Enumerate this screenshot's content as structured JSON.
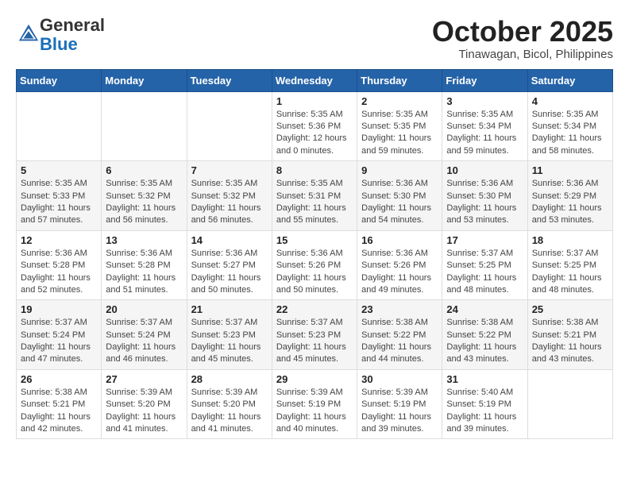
{
  "header": {
    "logo_general": "General",
    "logo_blue": "Blue",
    "month_title": "October 2025",
    "location": "Tinawagan, Bicol, Philippines"
  },
  "weekdays": [
    "Sunday",
    "Monday",
    "Tuesday",
    "Wednesday",
    "Thursday",
    "Friday",
    "Saturday"
  ],
  "weeks": [
    [
      {
        "day": "",
        "info": ""
      },
      {
        "day": "",
        "info": ""
      },
      {
        "day": "",
        "info": ""
      },
      {
        "day": "1",
        "info": "Sunrise: 5:35 AM\nSunset: 5:36 PM\nDaylight: 12 hours\nand 0 minutes."
      },
      {
        "day": "2",
        "info": "Sunrise: 5:35 AM\nSunset: 5:35 PM\nDaylight: 11 hours\nand 59 minutes."
      },
      {
        "day": "3",
        "info": "Sunrise: 5:35 AM\nSunset: 5:34 PM\nDaylight: 11 hours\nand 59 minutes."
      },
      {
        "day": "4",
        "info": "Sunrise: 5:35 AM\nSunset: 5:34 PM\nDaylight: 11 hours\nand 58 minutes."
      }
    ],
    [
      {
        "day": "5",
        "info": "Sunrise: 5:35 AM\nSunset: 5:33 PM\nDaylight: 11 hours\nand 57 minutes."
      },
      {
        "day": "6",
        "info": "Sunrise: 5:35 AM\nSunset: 5:32 PM\nDaylight: 11 hours\nand 56 minutes."
      },
      {
        "day": "7",
        "info": "Sunrise: 5:35 AM\nSunset: 5:32 PM\nDaylight: 11 hours\nand 56 minutes."
      },
      {
        "day": "8",
        "info": "Sunrise: 5:35 AM\nSunset: 5:31 PM\nDaylight: 11 hours\nand 55 minutes."
      },
      {
        "day": "9",
        "info": "Sunrise: 5:36 AM\nSunset: 5:30 PM\nDaylight: 11 hours\nand 54 minutes."
      },
      {
        "day": "10",
        "info": "Sunrise: 5:36 AM\nSunset: 5:30 PM\nDaylight: 11 hours\nand 53 minutes."
      },
      {
        "day": "11",
        "info": "Sunrise: 5:36 AM\nSunset: 5:29 PM\nDaylight: 11 hours\nand 53 minutes."
      }
    ],
    [
      {
        "day": "12",
        "info": "Sunrise: 5:36 AM\nSunset: 5:28 PM\nDaylight: 11 hours\nand 52 minutes."
      },
      {
        "day": "13",
        "info": "Sunrise: 5:36 AM\nSunset: 5:28 PM\nDaylight: 11 hours\nand 51 minutes."
      },
      {
        "day": "14",
        "info": "Sunrise: 5:36 AM\nSunset: 5:27 PM\nDaylight: 11 hours\nand 50 minutes."
      },
      {
        "day": "15",
        "info": "Sunrise: 5:36 AM\nSunset: 5:26 PM\nDaylight: 11 hours\nand 50 minutes."
      },
      {
        "day": "16",
        "info": "Sunrise: 5:36 AM\nSunset: 5:26 PM\nDaylight: 11 hours\nand 49 minutes."
      },
      {
        "day": "17",
        "info": "Sunrise: 5:37 AM\nSunset: 5:25 PM\nDaylight: 11 hours\nand 48 minutes."
      },
      {
        "day": "18",
        "info": "Sunrise: 5:37 AM\nSunset: 5:25 PM\nDaylight: 11 hours\nand 48 minutes."
      }
    ],
    [
      {
        "day": "19",
        "info": "Sunrise: 5:37 AM\nSunset: 5:24 PM\nDaylight: 11 hours\nand 47 minutes."
      },
      {
        "day": "20",
        "info": "Sunrise: 5:37 AM\nSunset: 5:24 PM\nDaylight: 11 hours\nand 46 minutes."
      },
      {
        "day": "21",
        "info": "Sunrise: 5:37 AM\nSunset: 5:23 PM\nDaylight: 11 hours\nand 45 minutes."
      },
      {
        "day": "22",
        "info": "Sunrise: 5:37 AM\nSunset: 5:23 PM\nDaylight: 11 hours\nand 45 minutes."
      },
      {
        "day": "23",
        "info": "Sunrise: 5:38 AM\nSunset: 5:22 PM\nDaylight: 11 hours\nand 44 minutes."
      },
      {
        "day": "24",
        "info": "Sunrise: 5:38 AM\nSunset: 5:22 PM\nDaylight: 11 hours\nand 43 minutes."
      },
      {
        "day": "25",
        "info": "Sunrise: 5:38 AM\nSunset: 5:21 PM\nDaylight: 11 hours\nand 43 minutes."
      }
    ],
    [
      {
        "day": "26",
        "info": "Sunrise: 5:38 AM\nSunset: 5:21 PM\nDaylight: 11 hours\nand 42 minutes."
      },
      {
        "day": "27",
        "info": "Sunrise: 5:39 AM\nSunset: 5:20 PM\nDaylight: 11 hours\nand 41 minutes."
      },
      {
        "day": "28",
        "info": "Sunrise: 5:39 AM\nSunset: 5:20 PM\nDaylight: 11 hours\nand 41 minutes."
      },
      {
        "day": "29",
        "info": "Sunrise: 5:39 AM\nSunset: 5:19 PM\nDaylight: 11 hours\nand 40 minutes."
      },
      {
        "day": "30",
        "info": "Sunrise: 5:39 AM\nSunset: 5:19 PM\nDaylight: 11 hours\nand 39 minutes."
      },
      {
        "day": "31",
        "info": "Sunrise: 5:40 AM\nSunset: 5:19 PM\nDaylight: 11 hours\nand 39 minutes."
      },
      {
        "day": "",
        "info": ""
      }
    ]
  ]
}
